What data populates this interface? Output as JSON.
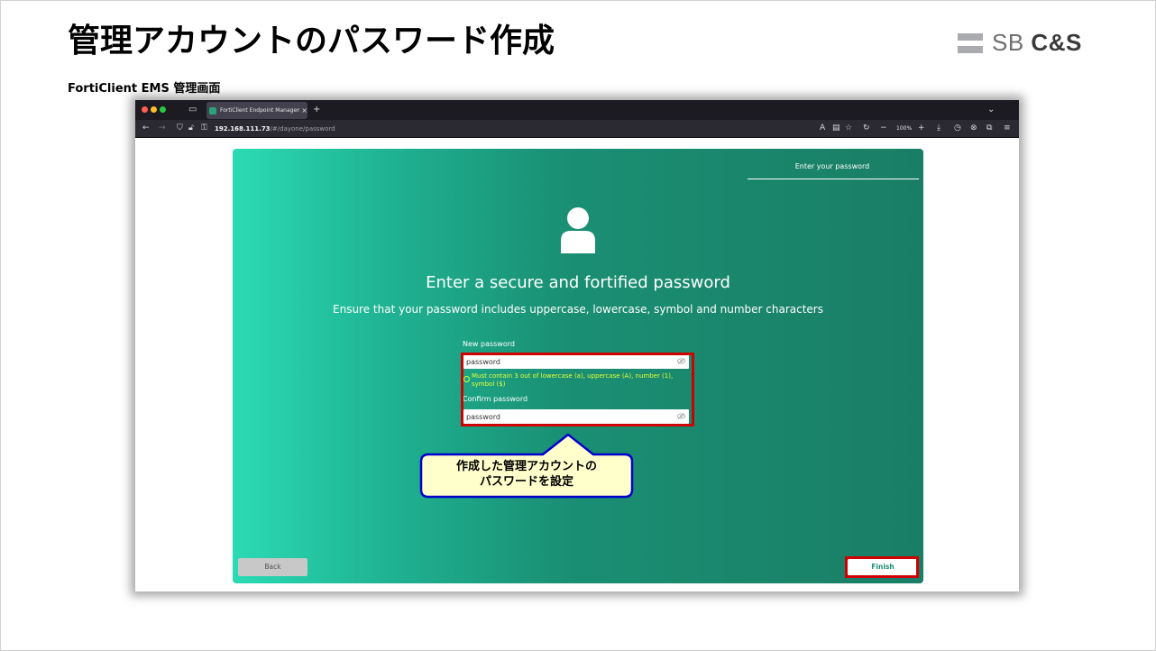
{
  "slide": {
    "title": "管理アカウントのパスワード作成",
    "subtitle": "FortiClient EMS 管理画面",
    "logo_prefix": "SB ",
    "logo_suffix": "C&S"
  },
  "browser": {
    "tab_title": "FortiClient Endpoint Manageme",
    "tab_close": "×",
    "new_tab": "+",
    "url_host": "192.168.111.73",
    "url_path": "/#/dayone/password",
    "zoom": "100%"
  },
  "app": {
    "step_label": "Enter your password",
    "heading": "Enter a secure and fortified password",
    "subheading": "Ensure that your password includes uppercase, lowercase, symbol and number characters",
    "new_password_label": "New password",
    "new_password_value": "password",
    "hint": "Must contain 3 out of lowercase (a), uppercase (A), number (1), symbol ($)",
    "confirm_password_label": "Confirm password",
    "confirm_password_value": "password",
    "back_button": "Back",
    "finish_button": "Finish"
  },
  "callout": {
    "line1": "作成した管理アカウントの",
    "line2": "パスワードを設定"
  },
  "colors": {
    "panel_start": "#2bdbb3",
    "panel_end": "#1a7e66",
    "highlight_red": "#d00000",
    "callout_fill": "#ffffcc",
    "callout_border": "#0000cc",
    "hint_text": "#e7ff39"
  }
}
